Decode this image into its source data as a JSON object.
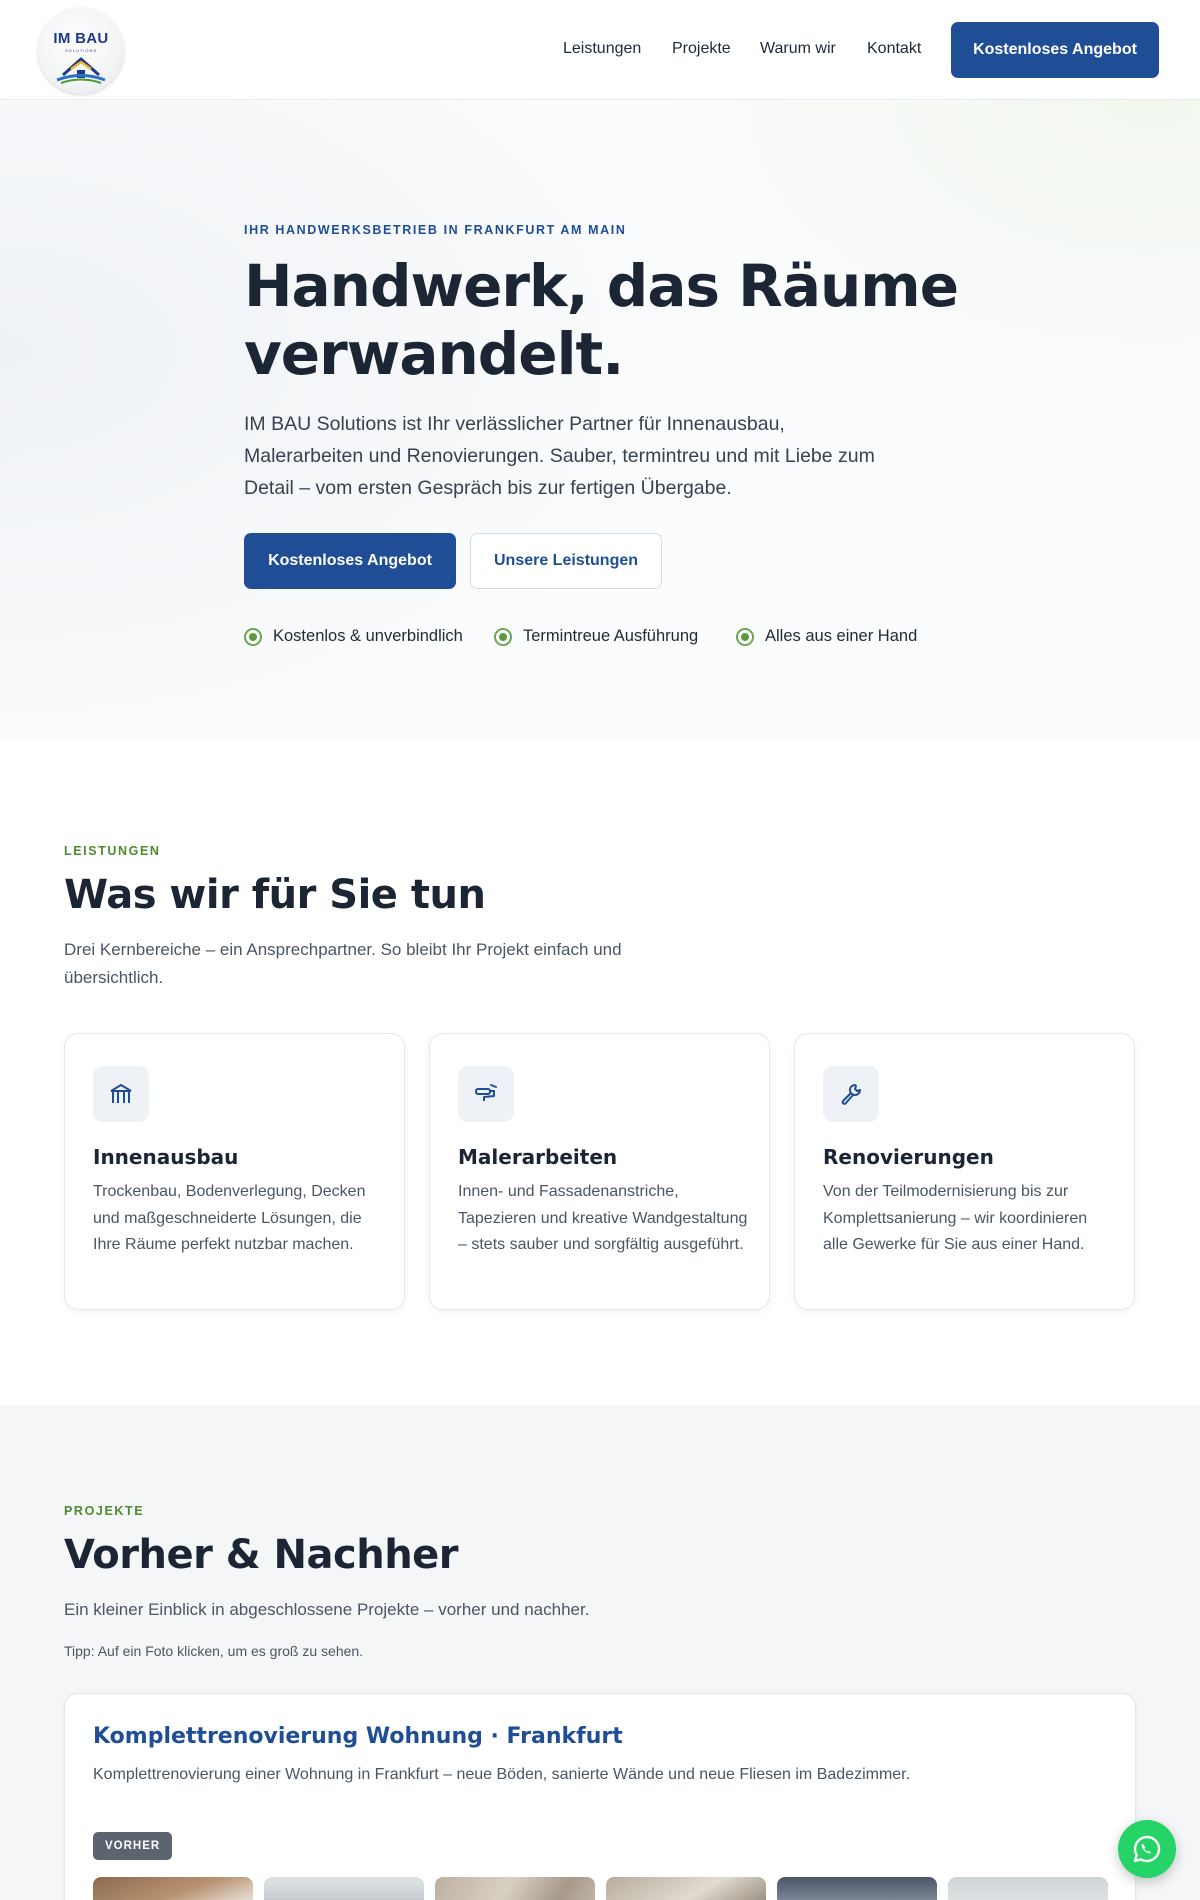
{
  "brand": {
    "logo_text": "IM BAU",
    "logo_sub": "SOLUTIONS"
  },
  "nav": {
    "items": [
      {
        "label": "Leistungen"
      },
      {
        "label": "Projekte"
      },
      {
        "label": "Warum wir"
      },
      {
        "label": "Kontakt"
      }
    ],
    "cta_label": "Kostenloses Angebot"
  },
  "hero": {
    "eyebrow": "IHR HANDWERKSBETRIEB IN FRANKFURT AM MAIN",
    "title": "Handwerk, das Räume verwandelt.",
    "text": "IM BAU Solutions ist Ihr verlässlicher Partner für Innenausbau, Malerarbeiten und Renovierungen. Sauber, termintreu und mit Liebe zum Detail – vom ersten Gespräch bis zur fertigen Übergabe.",
    "primary_button": "Kostenloses Angebot",
    "secondary_button": "Unsere Leistungen",
    "bullets": [
      "Kostenlos & unverbindlich",
      "Termintreue Ausführung",
      "Alles aus einer Hand"
    ]
  },
  "services": {
    "eyebrow": "LEISTUNGEN",
    "title": "Was wir für Sie tun",
    "text": "Drei Kernbereiche – ein Ansprechpartner. So bleibt Ihr Projekt einfach und übersichtlich.",
    "cards": [
      {
        "icon": "building-icon",
        "title": "Innenausbau",
        "text": "Trockenbau, Bodenverlegung, Decken und maßgeschneiderte Lösungen, die Ihre Räume perfekt nutzbar machen."
      },
      {
        "icon": "paint-roller-icon",
        "title": "Malerarbeiten",
        "text": "Innen- und Fassadenanstriche, Tapezieren und kreative Wandgestaltung – stets sauber und sorgfältig ausgeführt."
      },
      {
        "icon": "wrench-icon",
        "title": "Renovierungen",
        "text": "Von der Teilmodernisierung bis zur Komplettsanierung – wir koordinieren alle Gewerke für Sie aus einer Hand."
      }
    ]
  },
  "projects": {
    "eyebrow": "PROJEKTE",
    "title": "Vorher & Nachher",
    "text": "Ein kleiner Einblick in abgeschlossene Projekte – vorher und nachher.",
    "tip": "Tipp: Auf ein Foto klicken, um es groß zu sehen.",
    "items": [
      {
        "title": "Komplettrenovierung Wohnung · Frankfurt",
        "description": "Komplettrenovierung einer Wohnung in Frankfurt – neue Böden, sanierte Wände und neue Fliesen im Badezimmer.",
        "badge": "VORHER"
      }
    ]
  },
  "floating": {
    "whatsapp_icon": "whatsapp-icon"
  },
  "colors": {
    "primary": "#1f4e96",
    "accent_green": "#4e8a2e",
    "heading": "#1b2533",
    "whatsapp": "#25d366"
  }
}
